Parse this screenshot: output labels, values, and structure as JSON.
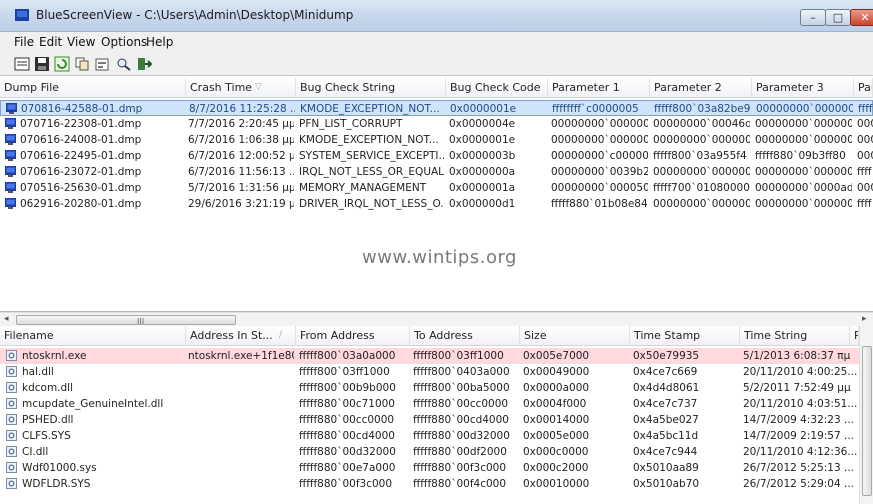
{
  "window": {
    "title": "BlueScreenView  -  C:\\Users\\Admin\\Desktop\\Minidump",
    "minimize_glyph": "–",
    "maximize_glyph": "□",
    "close_glyph": "✕"
  },
  "menu": [
    "File",
    "Edit",
    "View",
    "Options",
    "Help"
  ],
  "toolbar_icons": [
    "save-html-report-icon",
    "save-icon",
    "refresh-icon",
    "copy-icon",
    "properties-icon",
    "find-icon",
    "exit-icon"
  ],
  "top_table": {
    "headers": [
      "Dump File",
      "Crash Time",
      "Bug Check String",
      "Bug Check Code",
      "Parameter 1",
      "Parameter 2",
      "Parameter 3",
      "Par"
    ],
    "sort_indicator": "▽",
    "rows": [
      [
        "070816-42588-01.dmp",
        "8/7/2016 11:25:28 ...",
        "KMODE_EXCEPTION_NOT...",
        "0x0000001e",
        "ffffffff`c0000005",
        "fffff800`03a82be9",
        "00000000`000000...",
        "ffff"
      ],
      [
        "070716-22308-01.dmp",
        "7/7/2016 2:20:45 μμ",
        "PFN_LIST_CORRUPT",
        "0x0000004e",
        "00000000`000000...",
        "00000000`00046d7f",
        "00000000`000000...",
        "000"
      ],
      [
        "070616-24008-01.dmp",
        "6/7/2016 1:06:38 μμ",
        "KMODE_EXCEPTION_NOT...",
        "0x0000001e",
        "00000000`000000...",
        "00000000`000000...",
        "00000000`000000...",
        "000"
      ],
      [
        "070616-22495-01.dmp",
        "6/7/2016 12:00:52 μμ",
        "SYSTEM_SERVICE_EXCEPTI...",
        "0x0000003b",
        "00000000`c00000...",
        "fffff800`03a955f4",
        "fffff880`09b3ff80",
        "000"
      ],
      [
        "070616-23072-01.dmp",
        "6/7/2016 11:56:13 ...",
        "IRQL_NOT_LESS_OR_EQUAL",
        "0x0000000a",
        "00000000`0039b2...",
        "00000000`000000...",
        "00000000`000000...",
        "ffff"
      ],
      [
        "070516-25630-01.dmp",
        "5/7/2016 1:31:56 μμ",
        "MEMORY_MANAGEMENT",
        "0x0000001a",
        "00000000`000050...",
        "fffff700`01080000",
        "00000000`0000ad...",
        "000"
      ],
      [
        "062916-20280-01.dmp",
        "29/6/2016 3:21:19 μμ",
        "DRIVER_IRQL_NOT_LESS_O...",
        "0x000000d1",
        "fffff880`01b08e84",
        "00000000`000000...",
        "00000000`000000...",
        "ffff"
      ]
    ]
  },
  "watermark": "www.wintips.org",
  "scrollbar": {
    "left_arrow": "◂",
    "right_arrow": "▸",
    "grip": "III"
  },
  "bottom_table": {
    "headers": [
      "Filename",
      "Address In St...",
      "From Address",
      "To Address",
      "Size",
      "Time Stamp",
      "Time String",
      "Pr"
    ],
    "sort_indicator": "/",
    "rows": [
      [
        "ntoskrnl.exe",
        "ntoskrnl.exe+1f1e80",
        "fffff800`03a0a000",
        "fffff800`03ff1000",
        "0x005e7000",
        "0x50e79935",
        "5/1/2013 6:08:37 πμ"
      ],
      [
        "hal.dll",
        "",
        "fffff800`03ff1000",
        "fffff800`0403a000",
        "0x00049000",
        "0x4ce7c669",
        "20/11/2010 4:00:25..."
      ],
      [
        "kdcom.dll",
        "",
        "fffff800`00b9b000",
        "fffff800`00ba5000",
        "0x0000a000",
        "0x4d4d8061",
        "5/2/2011 7:52:49 μμ"
      ],
      [
        "mcupdate_GenuineIntel.dll",
        "",
        "fffff880`00c71000",
        "fffff880`00cc0000",
        "0x0004f000",
        "0x4ce7c737",
        "20/11/2010 4:03:51..."
      ],
      [
        "PSHED.dll",
        "",
        "fffff880`00cc0000",
        "fffff880`00cd4000",
        "0x00014000",
        "0x4a5be027",
        "14/7/2009 4:32:23 ..."
      ],
      [
        "CLFS.SYS",
        "",
        "fffff880`00cd4000",
        "fffff880`00d32000",
        "0x0005e000",
        "0x4a5bc11d",
        "14/7/2009 2:19:57 ..."
      ],
      [
        "CI.dll",
        "",
        "fffff880`00d32000",
        "fffff880`00df2000",
        "0x000c0000",
        "0x4ce7c944",
        "20/11/2010 4:12:36..."
      ],
      [
        "Wdf01000.sys",
        "",
        "fffff880`00e7a000",
        "fffff880`00f3c000",
        "0x000c2000",
        "0x5010aa89",
        "26/7/2012 5:25:13 ..."
      ],
      [
        "WDFLDR.SYS",
        "",
        "fffff880`00f3c000",
        "fffff880`00f4c000",
        "0x00010000",
        "0x5010ab70",
        "26/7/2012 5:29:04 ..."
      ]
    ]
  },
  "colors": {
    "selected_row": "#cfe3fb",
    "highlight_row": "#ffd9de",
    "dump_icon_blue": "#1c3fa8"
  }
}
